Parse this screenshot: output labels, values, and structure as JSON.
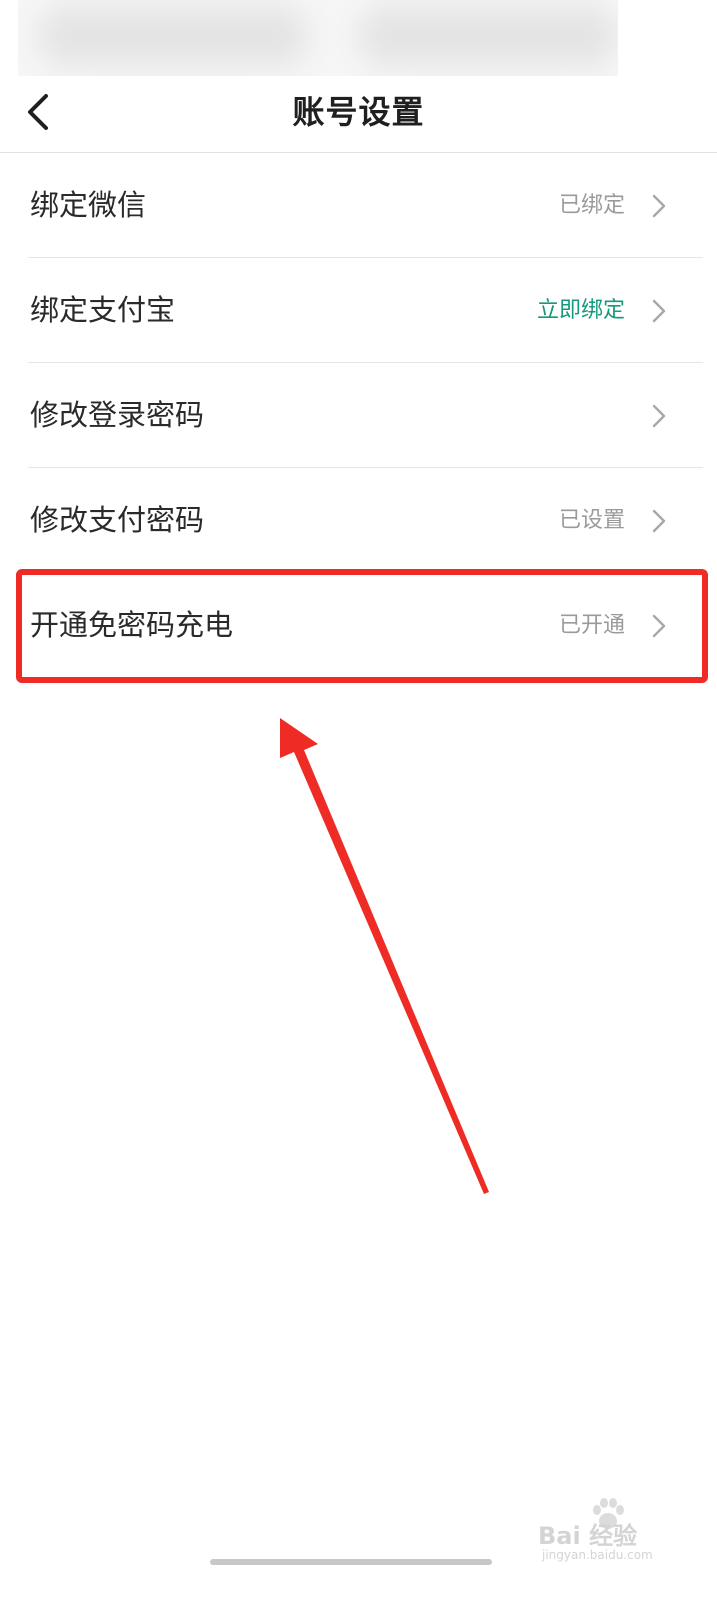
{
  "header": {
    "title": "账号设置",
    "back_icon": "chevron-left-icon"
  },
  "settings": [
    {
      "label": "绑定微信",
      "value": "已绑定",
      "value_color": "#9a9a9a"
    },
    {
      "label": "绑定支付宝",
      "value": "立即绑定",
      "value_color": "#14997c"
    },
    {
      "label": "修改登录密码",
      "value": "",
      "value_color": "#9a9a9a"
    },
    {
      "label": "修改支付密码",
      "value": "已设置",
      "value_color": "#9a9a9a"
    },
    {
      "label": "开通免密码充电",
      "value": "已开通",
      "value_color": "#9a9a9a"
    }
  ],
  "annotation": {
    "highlight_color": "#ee2b24",
    "highlighted_item": "开通免密码充电"
  },
  "watermark": {
    "text": "Bai 经验",
    "url": "jingyan.baidu.com"
  },
  "colors": {
    "accent": "#14997c",
    "text_primary": "#2a2a2a",
    "text_secondary": "#9a9a9a",
    "divider": "#e6e6e6"
  }
}
